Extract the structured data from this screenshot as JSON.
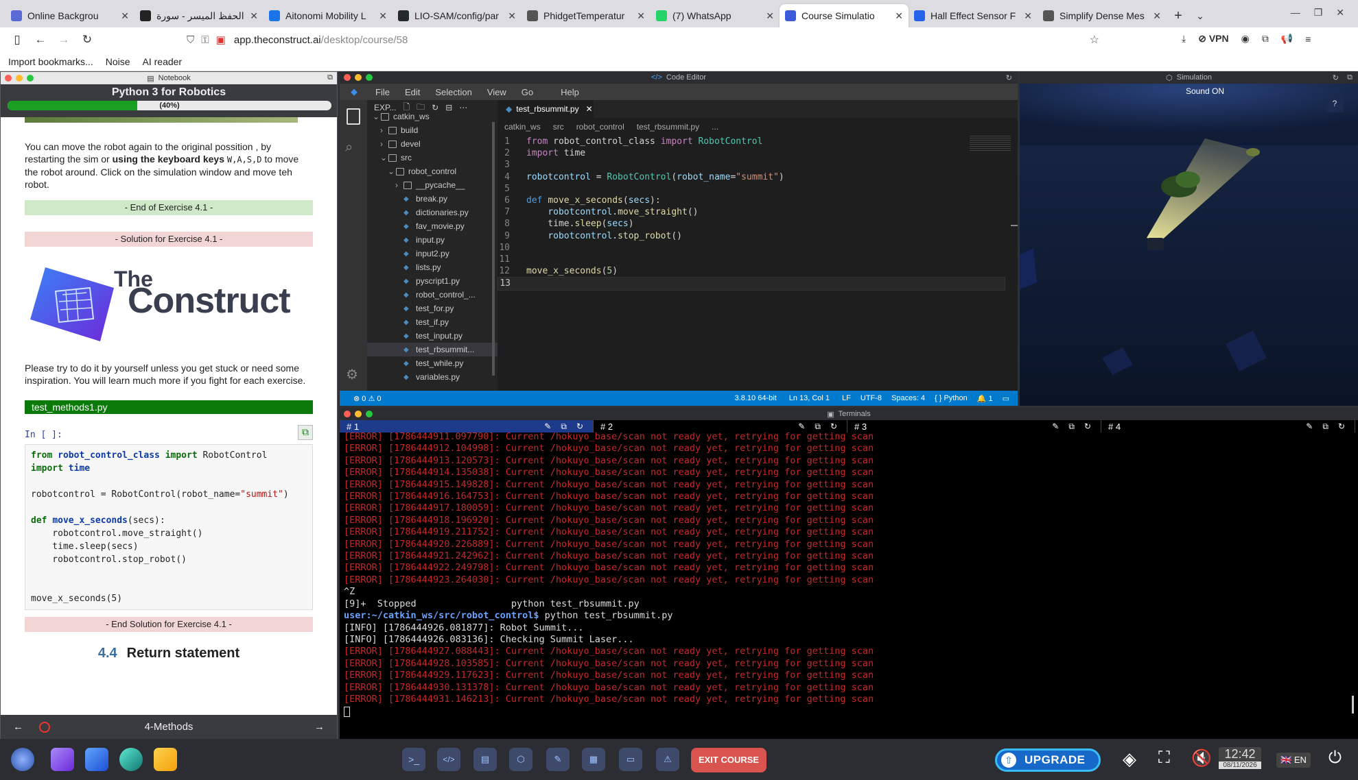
{
  "browser": {
    "tabs": [
      {
        "title": "Online Backgrou",
        "color": "#5a6bd6"
      },
      {
        "title": "الحفظ الميسر - سورة",
        "color": "#222222"
      },
      {
        "title": "Aitonomi Mobility L",
        "color": "#1a73e8"
      },
      {
        "title": "LIO-SAM/config/par",
        "color": "#24292f"
      },
      {
        "title": "PhidgetTemperatur",
        "color": "#555555"
      },
      {
        "title": "(7) WhatsApp",
        "color": "#25d366"
      },
      {
        "title": "Course Simulatio",
        "color": "#3b5bdb"
      },
      {
        "title": "Hall Effect Sensor F",
        "color": "#2563eb"
      },
      {
        "title": "Simplify Dense Mes",
        "color": "#555555"
      }
    ],
    "url_host": "app.theconstruct.ai",
    "url_path": "/desktop/course/58",
    "vpn_label": "VPN",
    "bookmarks": [
      "Import bookmarks...",
      "Noise",
      "AI reader"
    ]
  },
  "notebook": {
    "window_title": "Notebook",
    "course_title": "Python 3 for Robotics",
    "progress_label": "(40%)",
    "progress": 0.4,
    "para1_a": "You can move the robot again to the original possition , by restarting the sim or ",
    "para1_b": "using the keyboard keys",
    "para1_keys": "W,A,S,D",
    "para1_c": " to move the robot around. Click on the simulation window and move teh robot.",
    "end_ex": "- End of Exercise 4.1 -",
    "sol_ex": "- Solution for Exercise 4.1 -",
    "logo_the": "The",
    "logo_construct": "Construct",
    "para2": "Please try to do it by yourself unless you get stuck or need some inspiration. You will learn much more if you fight for each exercise.",
    "file_label": "test_methods1.py",
    "cell_prompt": "In [ ]:",
    "code": {
      "l1_from": "from",
      "l1_mod": "robot_control_class",
      "l1_import": "import",
      "l1_cls": "RobotControl",
      "l2_import": "import",
      "l2_mod": "time",
      "l3_a": "robotcontrol = RobotControl(robot_name=",
      "l3_str": "\"summit\"",
      "l3_b": ")",
      "l4_def": "def",
      "l4_fn": "move_x_seconds",
      "l4_args": "(secs):",
      "l5": "    robotcontrol.move_straight()",
      "l6": "    time.sleep(secs)",
      "l7": "    robotcontrol.stop_robot()",
      "l8": "move_x_seconds(5)"
    },
    "end_sol": "- End Solution for Exercise 4.1 -",
    "section_num": "4.4",
    "section_title": "Return statement",
    "footer_title": "4-Methods"
  },
  "editor": {
    "window_title": "Code Editor",
    "menu": [
      "File",
      "Edit",
      "Selection",
      "View",
      "Go",
      "Help"
    ],
    "explorer_title": "EXP...",
    "tree": [
      {
        "name": "catkin_ws",
        "type": "folder-open",
        "indent": 0
      },
      {
        "name": "build",
        "type": "folder",
        "indent": 1
      },
      {
        "name": "devel",
        "type": "folder",
        "indent": 1
      },
      {
        "name": "src",
        "type": "folder-open",
        "indent": 1
      },
      {
        "name": "robot_control",
        "type": "folder-open",
        "indent": 2
      },
      {
        "name": "__pycache__",
        "type": "folder",
        "indent": 3
      },
      {
        "name": "break.py",
        "type": "file",
        "indent": 3
      },
      {
        "name": "dictionaries.py",
        "type": "file",
        "indent": 3
      },
      {
        "name": "fav_movie.py",
        "type": "file",
        "indent": 3
      },
      {
        "name": "input.py",
        "type": "file",
        "indent": 3
      },
      {
        "name": "input2.py",
        "type": "file",
        "indent": 3
      },
      {
        "name": "lists.py",
        "type": "file",
        "indent": 3
      },
      {
        "name": "pyscript1.py",
        "type": "file",
        "indent": 3
      },
      {
        "name": "robot_control_...",
        "type": "file",
        "indent": 3
      },
      {
        "name": "test_for.py",
        "type": "file",
        "indent": 3
      },
      {
        "name": "test_if.py",
        "type": "file",
        "indent": 3
      },
      {
        "name": "test_input.py",
        "type": "file",
        "indent": 3
      },
      {
        "name": "test_rbsummit...",
        "type": "file",
        "indent": 3,
        "selected": true
      },
      {
        "name": "test_while.py",
        "type": "file",
        "indent": 3
      },
      {
        "name": "variables.py",
        "type": "file",
        "indent": 3
      }
    ],
    "tab": "test_rbsummit.py",
    "breadcrumbs": [
      "catkin_ws",
      "src",
      "robot_control",
      "test_rbsummit.py",
      "..."
    ],
    "line_numbers": [
      "1",
      "2",
      "3",
      "4",
      "5",
      "6",
      "7",
      "8",
      "9",
      "10",
      "11",
      "12",
      "13"
    ],
    "status": {
      "problems": "⊗ 0 ⚠ 0",
      "python_ver": "3.8.10 64-bit",
      "cursor": "Ln 13, Col 1",
      "eol": "LF",
      "encoding": "UTF-8",
      "spaces": "Spaces: 4",
      "lang": "Python",
      "notif": "1"
    }
  },
  "simulation": {
    "window_title": "Simulation",
    "sound": "Sound ON",
    "help": "?"
  },
  "terminal": {
    "window_title": "Terminals",
    "tabs": [
      "# 1",
      "# 2",
      "# 3",
      "# 4"
    ],
    "lines": [
      {
        "t": "[ERROR] [1786444911.097790]: Current /hokuyo_base/scan not ready yet, retrying for getting scan",
        "c": "er"
      },
      {
        "t": "[ERROR] [1786444912.104998]: Current /hokuyo_base/scan not ready yet, retrying for getting scan",
        "c": "er"
      },
      {
        "t": "[ERROR] [1786444913.120573]: Current /hokuyo_base/scan not ready yet, retrying for getting scan",
        "c": "er"
      },
      {
        "t": "[ERROR] [1786444914.135038]: Current /hokuyo_base/scan not ready yet, retrying for getting scan",
        "c": "er"
      },
      {
        "t": "[ERROR] [1786444915.149828]: Current /hokuyo_base/scan not ready yet, retrying for getting scan",
        "c": "er"
      },
      {
        "t": "[ERROR] [1786444916.164753]: Current /hokuyo_base/scan not ready yet, retrying for getting scan",
        "c": "er"
      },
      {
        "t": "[ERROR] [1786444917.180059]: Current /hokuyo_base/scan not ready yet, retrying for getting scan",
        "c": "er"
      },
      {
        "t": "[ERROR] [1786444918.196920]: Current /hokuyo_base/scan not ready yet, retrying for getting scan",
        "c": "er"
      },
      {
        "t": "[ERROR] [1786444919.211752]: Current /hokuyo_base/scan not ready yet, retrying for getting scan",
        "c": "er"
      },
      {
        "t": "[ERROR] [1786444920.226889]: Current /hokuyo_base/scan not ready yet, retrying for getting scan",
        "c": "er"
      },
      {
        "t": "[ERROR] [1786444921.242962]: Current /hokuyo_base/scan not ready yet, retrying for getting scan",
        "c": "er"
      },
      {
        "t": "[ERROR] [1786444922.249798]: Current /hokuyo_base/scan not ready yet, retrying for getting scan",
        "c": "er"
      },
      {
        "t": "[ERROR] [1786444923.264030]: Current /hokuyo_base/scan not ready yet, retrying for getting scan",
        "c": "er"
      },
      {
        "t": "^Z",
        "c": ""
      },
      {
        "t": "[9]+  Stopped                 python test_rbsummit.py",
        "c": ""
      },
      {
        "t": "",
        "c": "prompt"
      },
      {
        "t": "[INFO] [1786444926.081877]: Robot Summit...",
        "c": ""
      },
      {
        "t": "[INFO] [1786444926.083136]: Checking Summit Laser...",
        "c": ""
      },
      {
        "t": "[ERROR] [1786444927.088443]: Current /hokuyo_base/scan not ready yet, retrying for getting scan",
        "c": "er"
      },
      {
        "t": "[ERROR] [1786444928.103585]: Current /hokuyo_base/scan not ready yet, retrying for getting scan",
        "c": "er"
      },
      {
        "t": "[ERROR] [1786444929.117623]: Current /hokuyo_base/scan not ready yet, retrying for getting scan",
        "c": "er"
      },
      {
        "t": "[ERROR] [1786444930.131378]: Current /hokuyo_base/scan not ready yet, retrying for getting scan",
        "c": "er"
      },
      {
        "t": "[ERROR] [1786444931.146213]: Current /hokuyo_base/scan not ready yet, retrying for getting scan",
        "c": "er"
      }
    ],
    "prompt_user": "user:~/catkin_ws/src/robot_control$",
    "prompt_cmd": " python test_rbsummit.py"
  },
  "taskbar": {
    "exit_label": "EXIT COURSE",
    "upgrade_label": "UPGRADE",
    "time": "12:42",
    "date": "08/11/2026",
    "lang": "EN"
  },
  "colors": {
    "accent_green": "#1a9e22",
    "exit_red": "#d9534f",
    "upgrade_blue": "#1769c9",
    "vscode_blue": "#007acc"
  }
}
